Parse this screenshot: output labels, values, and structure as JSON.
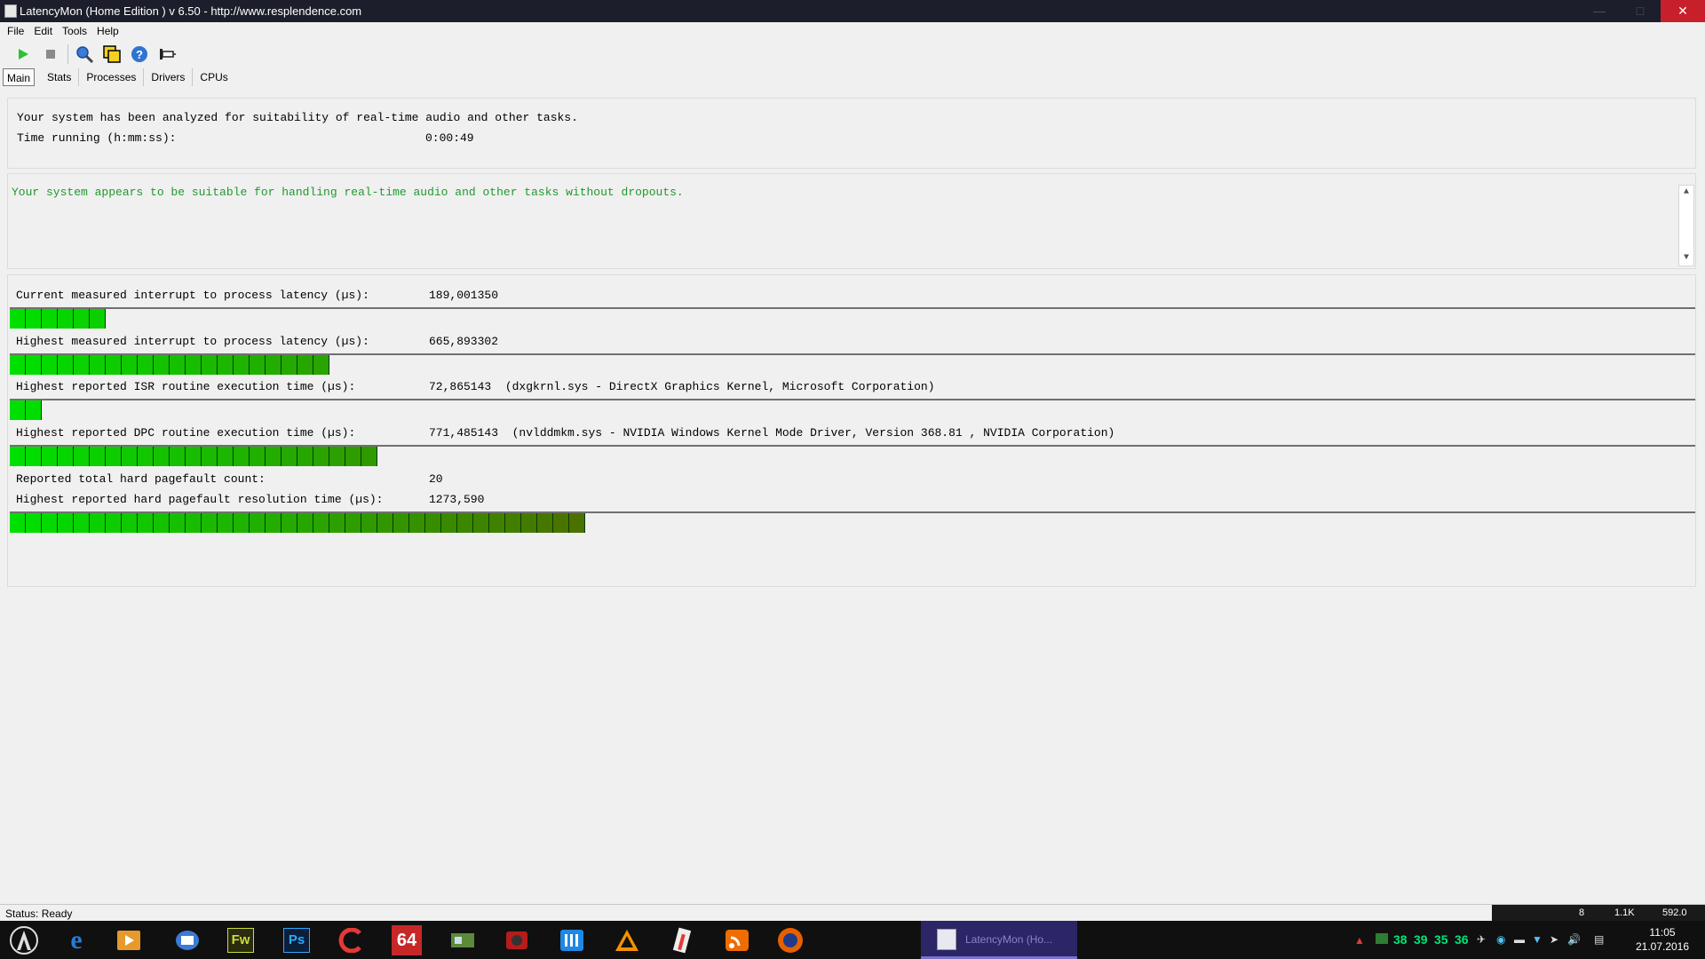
{
  "window": {
    "title": "LatencyMon  (Home Edition )  v 6.50 - http://www.resplendence.com",
    "minimize": "—",
    "maximize": "□",
    "close": "✕"
  },
  "menu": [
    "File",
    "Edit",
    "Tools",
    "Help"
  ],
  "toolbar": {
    "icons": [
      "play-icon",
      "stop-icon",
      "search-tool-icon",
      "cpu-icon",
      "help-icon",
      "pin-icon"
    ]
  },
  "tabs": [
    "Main",
    "Stats",
    "Processes",
    "Drivers",
    "CPUs"
  ],
  "summary": {
    "analyzed": "Your system has been analyzed for suitability of real-time audio and other tasks.",
    "time_label": "Time running (h:mm:ss):",
    "time_value": "0:00:49"
  },
  "conclusion": "Your system appears to be suitable for handling real-time audio and other tasks without dropouts.",
  "metrics": [
    {
      "label": "Current measured interrupt to process latency (µs):",
      "value": "189,001350",
      "detail": "",
      "level": 0.056
    },
    {
      "label": "Highest measured interrupt to process latency (µs):",
      "value": "665,893302",
      "detail": "",
      "level": 0.19
    },
    {
      "label": "Highest reported ISR routine execution time (µs):",
      "value": "72,865143",
      "detail": "(dxgkrnl.sys - DirectX Graphics Kernel, Microsoft Corporation)",
      "level": 0.019
    },
    {
      "label": "Highest reported DPC routine execution time (µs):",
      "value": "771,485143",
      "detail": "(nvlddmkm.sys - NVIDIA Windows Kernel Mode Driver, Version 368.81 , NVIDIA Corporation)",
      "level": 0.22
    },
    {
      "label": "Reported total hard pagefault count:",
      "value": "20",
      "detail": ""
    },
    {
      "label": "Highest reported hard pagefault resolution time (µs):",
      "value": "1273,590",
      "detail": "",
      "level": 0.337
    }
  ],
  "status": {
    "text": "Status: Ready",
    "right_items": [
      "8",
      "1.1K",
      "592.0"
    ]
  },
  "taskbar": {
    "apps": [
      "Windows",
      "Edge",
      "Video",
      "Mail",
      "Fw",
      "Ps",
      "CCleaner",
      "64",
      "GPU",
      "Lion",
      "Audio",
      "VLC",
      "Thermo",
      "RSS",
      "Firefox"
    ],
    "active_app": "LatencyMon  (Ho...",
    "temps": [
      "38",
      "39",
      "35",
      "36"
    ],
    "time": "11:05",
    "date": "21.07.2016"
  },
  "colors": {
    "conclusion_green": "#1f9a2c",
    "bar_start": "#00e000",
    "bar_end": "#5a5a00"
  }
}
